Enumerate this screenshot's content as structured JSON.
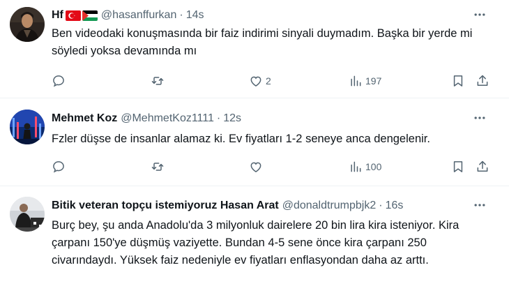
{
  "tweets": [
    {
      "name": "Hf",
      "handle": "@hasanffurkan",
      "time": "14s",
      "text": "Ben videodaki konuşmasında bir faiz indirimi sinyali duymadım. Başka bir yerde mi söyledi yoksa devamında mı",
      "likes": "2",
      "views": "197"
    },
    {
      "name": "Mehmet Koz",
      "handle": "@MehmetKoz1111",
      "time": "12s",
      "text": "Fzler düşse de insanlar alamaz ki. Ev fiyatları 1-2 seneye anca dengelenir.",
      "views": "100"
    },
    {
      "name": "Bitik veteran topçu istemiyoruz Hasan Arat",
      "handle": "@donaldtrumpbjk2",
      "time": "16s",
      "text": "Burç bey, şu anda Anadolu'da 3 milyonluk dairelere 20 bin lira kira isteniyor. Kira çarpanı 150'ye düşmüş vaziyette. Bundan 4-5 sene önce kira çarpanı 250 civarındaydı. Yüksek faiz nedeniyle ev fiyatları enflasyondan daha az arttı."
    }
  ],
  "separator": "·",
  "icons": [
    "more-icon",
    "reply-icon",
    "retweet-icon",
    "like-icon",
    "views-icon",
    "bookmark-icon",
    "share-icon"
  ],
  "colors": {
    "muted": "#536471",
    "text": "#0f1419",
    "divider": "#eff3f4"
  }
}
